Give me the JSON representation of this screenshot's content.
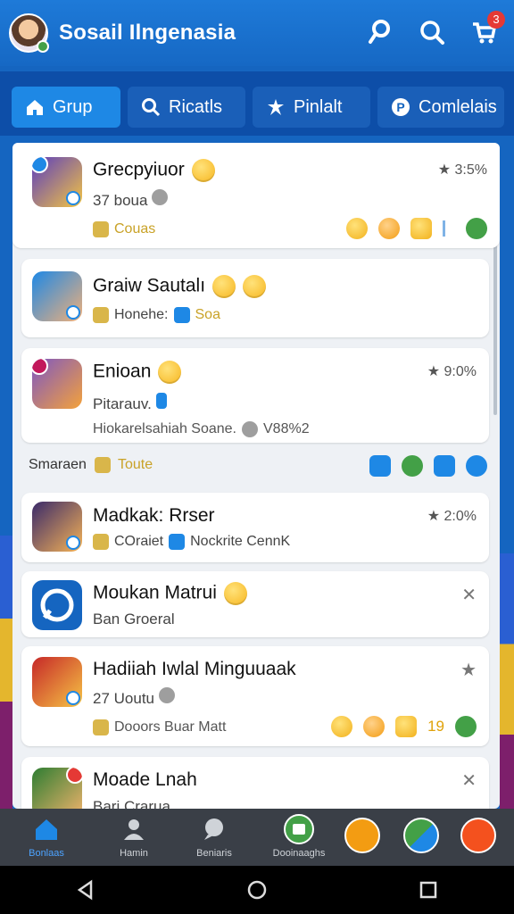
{
  "header": {
    "title": "Sosail Ilngenasia",
    "icons": [
      "avatar",
      "pin-icon",
      "search-icon",
      "cart-icon"
    ],
    "cart_badge": "3"
  },
  "tabs": [
    {
      "label": "Grup",
      "icon": "home-icon",
      "active": true
    },
    {
      "label": "Ricatls",
      "icon": "search-icon",
      "active": false
    },
    {
      "label": "Pinlalt",
      "icon": "puzzle-icon",
      "active": false
    },
    {
      "label": "Comlelais",
      "icon": "info-icon",
      "active": false
    }
  ],
  "list": [
    {
      "title": "Grecpyiuor",
      "subtitle": "37 boua",
      "meta": "Couas",
      "rating": "★ 3:5%"
    },
    {
      "title": "Graiw Sautalı",
      "meta1": "Honehe:",
      "meta2": "Soa"
    },
    {
      "title": "Enioan",
      "subtitle": "Pitarauv.",
      "meta": "Hiokarelsahiah Soane.",
      "meta_count": "V88%2",
      "rating": "★ 9:0%"
    },
    {
      "title": "Madkak: Rrser",
      "meta1": "COraiet",
      "meta2": "Nockrite CennK",
      "rating": "★ 2:0%"
    },
    {
      "title": "Moukan Matrui",
      "subtitle": "Ban Groeral",
      "more": "✕"
    },
    {
      "title": "Hadiiah Iwlal Minguuaak",
      "subtitle": "27 Uoutu",
      "meta": "Dooors Buar Matt",
      "count": "19",
      "more": "★"
    },
    {
      "title": "Moade Lnah",
      "subtitle": "Bari Crarua",
      "more": "✕"
    }
  ],
  "separator": {
    "label": "Smaraen",
    "meta": "Toute"
  },
  "bottom_nav": [
    {
      "label": "Bonlaas",
      "icon": "home-icon",
      "active": true
    },
    {
      "label": "Hamin",
      "icon": "person-icon",
      "active": false
    },
    {
      "label": "Beniaris",
      "icon": "chat-icon",
      "active": false
    },
    {
      "label": "Dooinaaghs",
      "icon": "group-icon",
      "active": false
    }
  ],
  "colors": {
    "primary": "#1e88e5",
    "header": "#1668c4",
    "tabs_bg": "#0d4ea8",
    "gold": "#c9a227"
  }
}
